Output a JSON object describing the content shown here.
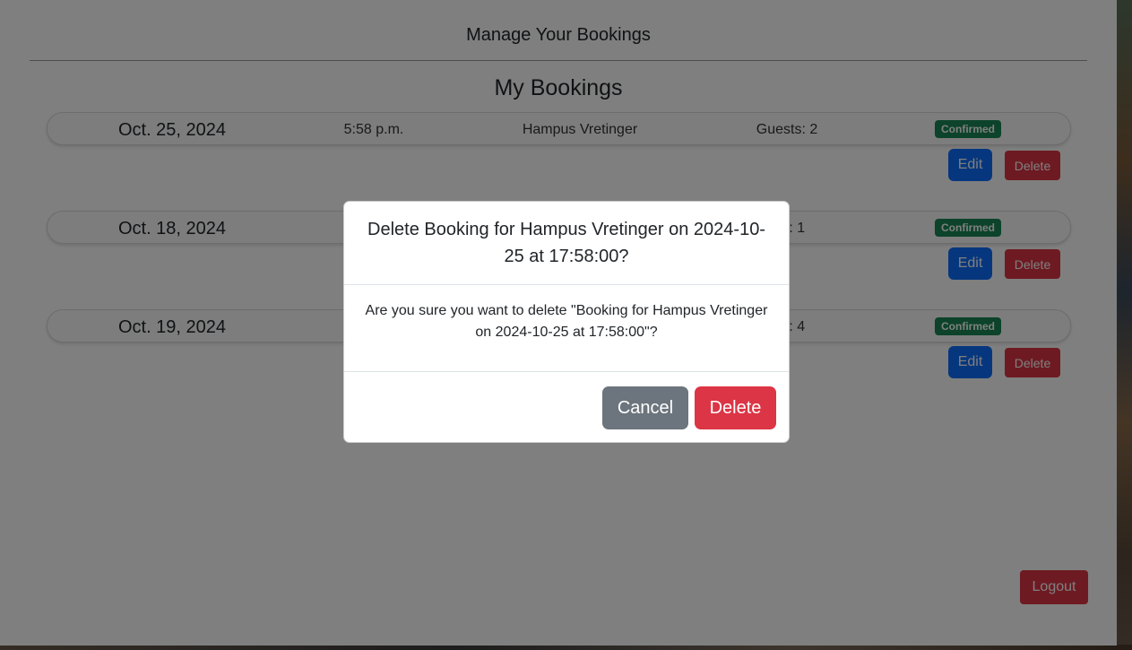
{
  "header": {
    "title": "Manage Your Bookings"
  },
  "section": {
    "title": "My Bookings"
  },
  "bookings": [
    {
      "date": "Oct. 25, 2024",
      "time": "5:58 p.m.",
      "name": "Hampus Vretinger",
      "guests": "Guests: 2",
      "status": "Confirmed",
      "edit_label": "Edit",
      "delete_label": "Delete"
    },
    {
      "date": "Oct. 18, 2024",
      "time": "",
      "name": "",
      "guests": "ts: 1",
      "status": "Confirmed",
      "edit_label": "Edit",
      "delete_label": "Delete"
    },
    {
      "date": "Oct. 19, 2024",
      "time": "",
      "name": "",
      "guests": "ts: 4",
      "status": "Confirmed",
      "edit_label": "Edit",
      "delete_label": "Delete"
    }
  ],
  "logout_label": "Logout",
  "modal": {
    "title": "Delete Booking for Hampus Vretinger on 2024-10-25 at 17:58:00?",
    "body": "Are you sure you want to delete \"Booking for Hampus Vretinger on 2024-10-25 at 17:58:00\"?",
    "cancel_label": "Cancel",
    "delete_label": "Delete"
  },
  "colors": {
    "primary": "#0d6efd",
    "danger": "#dc3545",
    "success": "#198754",
    "secondary": "#6c757d"
  }
}
